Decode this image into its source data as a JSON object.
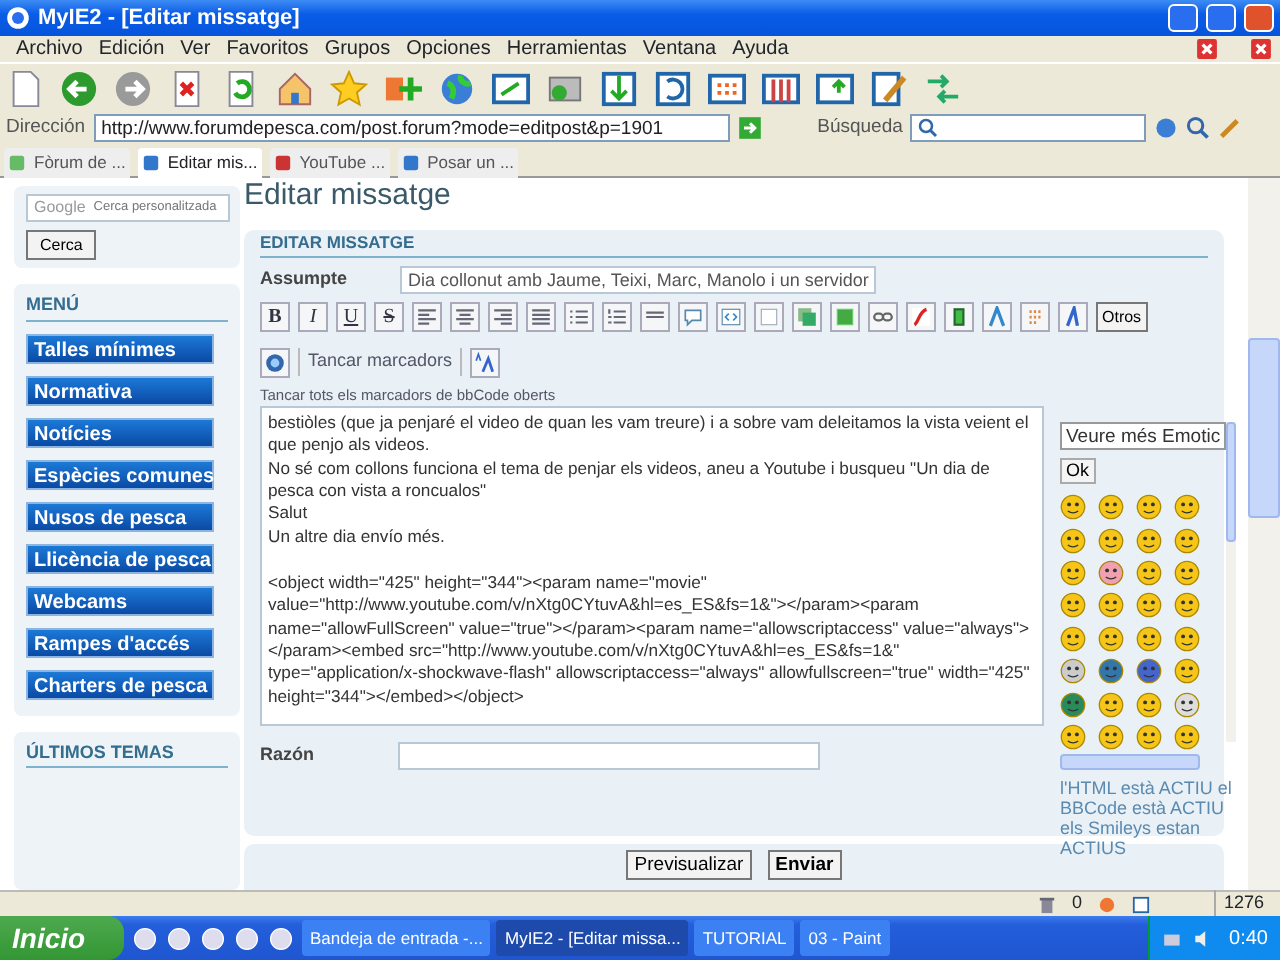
{
  "window": {
    "title": "MyIE2 - [Editar missatge]"
  },
  "menu": [
    "Archivo",
    "Edición",
    "Ver",
    "Favoritos",
    "Grupos",
    "Opciones",
    "Herramientas",
    "Ventana",
    "Ayuda"
  ],
  "address_bar": {
    "label": "Dirección",
    "url": "http://www.forumdepesca.com/post.forum?mode=editpost&p=1901"
  },
  "search_bar": {
    "label": "Búsqueda"
  },
  "tabs": [
    {
      "label": "Fòrum de ...",
      "selected": false
    },
    {
      "label": "Editar mis...",
      "selected": true
    },
    {
      "label": "YouTube ...",
      "selected": false
    },
    {
      "label": "Posar un ...",
      "selected": false
    }
  ],
  "sidebar": {
    "search": {
      "logo": "Google",
      "placeholder": "Cerca personalitzada",
      "button": "Cerca"
    },
    "menu_title": "MENÚ",
    "menu_items": [
      "Talles mínimes",
      "Normativa",
      "Notícies",
      "Espècies comunes",
      "Nusos de pesca",
      "Llicència de pesca",
      "Webcams",
      "Rampes d'accés",
      "Charters de pesca"
    ],
    "recent_title": "ÚLTIMOS TEMAS"
  },
  "page": {
    "heading": "Editar missatge",
    "panel_title": "EDITAR MISSATGE",
    "subject_label": "Assumpte",
    "subject_value": "Dia collonut amb Jaume, Teixi, Marc, Manolo i un servidor",
    "format_buttons": [
      {
        "label": "B",
        "kind": "bold"
      },
      {
        "label": "I",
        "kind": "italic"
      },
      {
        "label": "U",
        "kind": "underline"
      },
      {
        "label": "S",
        "kind": "strike"
      }
    ],
    "other_button": "Otros",
    "close_tags_button": "Tancar marcadors",
    "hint": "Tancar tots els marcadors de bbCode oberts",
    "message": "bestiòles (que ja penjaré el video de quan les vam treure) i a sobre vam deleitamos la vista veient el que penjo als videos.\nNo sé com collons funciona el tema de penjar els videos, aneu a Youtube i busqueu \"Un dia de pesca con vista a roncualos\"\nSalut\nUn altre dia envío més.\n\n<object width=\"425\" height=\"344\"><param name=\"movie\" value=\"http://www.youtube.com/v/nXtg0CYtuvA&hl=es_ES&fs=1&\"></param><param name=\"allowFullScreen\" value=\"true\"></param><param name=\"allowscriptaccess\" value=\"always\"></param><embed src=\"http://www.youtube.com/v/nXtg0CYtuvA&hl=es_ES&fs=1&\" type=\"application/x-shockwave-flash\" allowscriptaccess=\"always\" allowfullscreen=\"true\" width=\"425\" height=\"344\"></embed></object>",
    "emoticons": {
      "dropdown": "Veure més Emotic",
      "ok": "Ok",
      "status": "l'HTML està ACTIU el BBCode està ACTIU els Smileys estan ACTIUS"
    },
    "reason_label": "Razón",
    "buttons": [
      "Previsualizar",
      "Enviar"
    ]
  },
  "status_bar": {
    "trash_count": "0",
    "size": "1276"
  },
  "taskbar": {
    "start": "Inicio",
    "tasks": [
      {
        "label": "Bandeja de entrada -...",
        "selected": false
      },
      {
        "label": "MyIE2 - [Editar missa...",
        "selected": true
      },
      {
        "label": "TUTORIAL",
        "selected": false
      },
      {
        "label": "03 - Paint",
        "selected": false
      }
    ],
    "clock": "0:40"
  }
}
